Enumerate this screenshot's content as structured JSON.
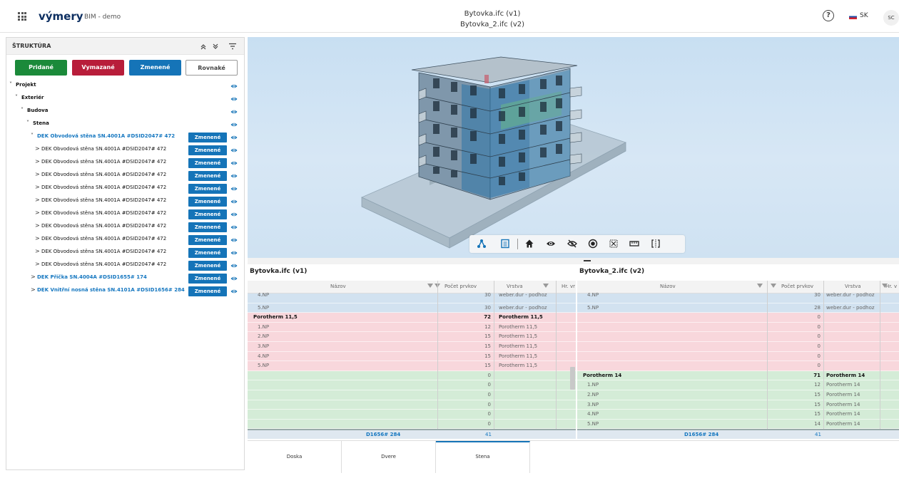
{
  "header": {
    "app_title": "výmery",
    "app_subtitle": "BIM - demo",
    "file_v1": "Bytovka.ifc (v1)",
    "file_v2": "Bytovka_2.ifc (v2)",
    "help_symbol": "?",
    "language": "SK",
    "user_initials": "SC"
  },
  "sidebar": {
    "title": "ŠTRUKTÚRA",
    "collapse_all_symbol": "⌃",
    "filters": [
      {
        "label": "Pridané",
        "color": "#1b8a3a"
      },
      {
        "label": "Vymazané",
        "color": "#b81d3a"
      },
      {
        "label": "Zmenené",
        "color": "#1574b8"
      },
      {
        "label": "Rovnaké",
        "color": "#ffffff"
      }
    ],
    "tree": [
      {
        "label": "Projekt",
        "level": 0,
        "chevron": "˅",
        "style": "bold"
      },
      {
        "label": "Exteriér",
        "level": 1,
        "chevron": "˅",
        "style": "bold"
      },
      {
        "label": "Budova",
        "level": 2,
        "chevron": "˅",
        "style": "bold"
      },
      {
        "label": "Stena",
        "level": 3,
        "chevron": "˅",
        "style": "bold"
      },
      {
        "label": "DEK Obvodová stěna SN.4001A #DSID2047# 472",
        "level": 4,
        "chevron": "˅",
        "style": "blue",
        "badge": "Zmenené"
      },
      {
        "label": "DEK Obvodová stěna SN.4001A #DSID2047# 472",
        "level": 5,
        "chevron": ">",
        "style": "normal",
        "badge": "Zmenené"
      },
      {
        "label": "DEK Obvodová stěna SN.4001A #DSID2047# 472",
        "level": 5,
        "chevron": ">",
        "style": "normal",
        "badge": "Zmenené"
      },
      {
        "label": "DEK Obvodová stěna SN.4001A #DSID2047# 472",
        "level": 5,
        "chevron": ">",
        "style": "normal",
        "badge": "Zmenené"
      },
      {
        "label": "DEK Obvodová stěna SN.4001A #DSID2047# 472",
        "level": 5,
        "chevron": ">",
        "style": "normal",
        "badge": "Zmenené"
      },
      {
        "label": "DEK Obvodová stěna SN.4001A #DSID2047# 472",
        "level": 5,
        "chevron": ">",
        "style": "normal",
        "badge": "Zmenené"
      },
      {
        "label": "DEK Obvodová stěna SN.4001A #DSID2047# 472",
        "level": 5,
        "chevron": ">",
        "style": "normal",
        "badge": "Zmenené"
      },
      {
        "label": "DEK Obvodová stěna SN.4001A #DSID2047# 472",
        "level": 5,
        "chevron": ">",
        "style": "normal",
        "badge": "Zmenené"
      },
      {
        "label": "DEK Obvodová stěna SN.4001A #DSID2047# 472",
        "level": 5,
        "chevron": ">",
        "style": "normal",
        "badge": "Zmenené"
      },
      {
        "label": "DEK Obvodová stěna SN.4001A #DSID2047# 472",
        "level": 5,
        "chevron": ">",
        "style": "normal",
        "badge": "Zmenené"
      },
      {
        "label": "DEK Obvodová stěna SN.4001A #DSID2047# 472",
        "level": 5,
        "chevron": ">",
        "style": "normal",
        "badge": "Zmenené"
      },
      {
        "label": "DEK Příčka SN.4004A #DSID1655# 174",
        "level": 4,
        "chevron": ">",
        "style": "blue",
        "badge": "Zmenené"
      },
      {
        "label": "DEK Vnitřní nosná stěna SN.4101A #DSID1656# 284",
        "level": 4,
        "chevron": ">",
        "style": "blue",
        "badge": "Zmenené"
      }
    ]
  },
  "tables": {
    "left": {
      "title": "Bytovka.ifc (v1)",
      "columns": [
        "Názov",
        "Počet prvkov",
        "Vrstva",
        "Hr. vr"
      ],
      "rows": [
        {
          "name": "4.NP",
          "count": "30",
          "layer": "weber.dur - podhoz",
          "type": "blue",
          "cut": true
        },
        {
          "name": "5.NP",
          "count": "30",
          "layer": "weber.dur - podhoz",
          "type": "blue"
        },
        {
          "name": "Porotherm 11,5",
          "count": "72",
          "layer": "Porotherm 11,5",
          "type": "red",
          "bold": true
        },
        {
          "name": "1.NP",
          "count": "12",
          "layer": "Porotherm 11,5",
          "type": "red"
        },
        {
          "name": "2.NP",
          "count": "15",
          "layer": "Porotherm 11,5",
          "type": "red"
        },
        {
          "name": "3.NP",
          "count": "15",
          "layer": "Porotherm 11,5",
          "type": "red"
        },
        {
          "name": "4.NP",
          "count": "15",
          "layer": "Porotherm 11,5",
          "type": "red"
        },
        {
          "name": "5.NP",
          "count": "15",
          "layer": "Porotherm 11,5",
          "type": "red"
        },
        {
          "name": "",
          "count": "0",
          "layer": "",
          "type": "green"
        },
        {
          "name": "",
          "count": "0",
          "layer": "",
          "type": "green"
        },
        {
          "name": "",
          "count": "0",
          "layer": "",
          "type": "green"
        },
        {
          "name": "",
          "count": "0",
          "layer": "",
          "type": "green"
        },
        {
          "name": "",
          "count": "0",
          "layer": "",
          "type": "green"
        },
        {
          "name": "",
          "count": "0",
          "layer": "",
          "type": "green"
        }
      ],
      "footer": {
        "name": "D1656# 284",
        "count": "41"
      }
    },
    "right": {
      "title": "Bytovka_2.ifc (v2)",
      "columns": [
        "Názov",
        "Počet prvkov",
        "Vrstva",
        "Hr. v"
      ],
      "rows": [
        {
          "name": "4.NP",
          "count": "30",
          "layer": "weber.dur - podhoz",
          "type": "blue",
          "cut": true
        },
        {
          "name": "5.NP",
          "count": "28",
          "layer": "weber.dur - podhoz",
          "type": "blue"
        },
        {
          "name": "",
          "count": "0",
          "layer": "",
          "type": "red"
        },
        {
          "name": "",
          "count": "0",
          "layer": "",
          "type": "red"
        },
        {
          "name": "",
          "count": "0",
          "layer": "",
          "type": "red"
        },
        {
          "name": "",
          "count": "0",
          "layer": "",
          "type": "red"
        },
        {
          "name": "",
          "count": "0",
          "layer": "",
          "type": "red"
        },
        {
          "name": "",
          "count": "0",
          "layer": "",
          "type": "red"
        },
        {
          "name": "Porotherm 14",
          "count": "71",
          "layer": "Porotherm 14",
          "type": "green",
          "bold": true
        },
        {
          "name": "1.NP",
          "count": "12",
          "layer": "Porotherm 14",
          "type": "green"
        },
        {
          "name": "2.NP",
          "count": "15",
          "layer": "Porotherm 14",
          "type": "green"
        },
        {
          "name": "3.NP",
          "count": "15",
          "layer": "Porotherm 14",
          "type": "green"
        },
        {
          "name": "4.NP",
          "count": "15",
          "layer": "Porotherm 14",
          "type": "green"
        },
        {
          "name": "5.NP",
          "count": "14",
          "layer": "Porotherm 14",
          "type": "green"
        }
      ],
      "footer": {
        "name": "D1656# 284",
        "count": "41"
      }
    }
  },
  "bottom_tabs": [
    "Doska",
    "Dvere",
    "Stena"
  ],
  "colors": {
    "blue_row": "#d2e2f0",
    "red_row": "#f8d7dc",
    "green_row": "#d4ecd7",
    "accent": "#1574b8"
  }
}
